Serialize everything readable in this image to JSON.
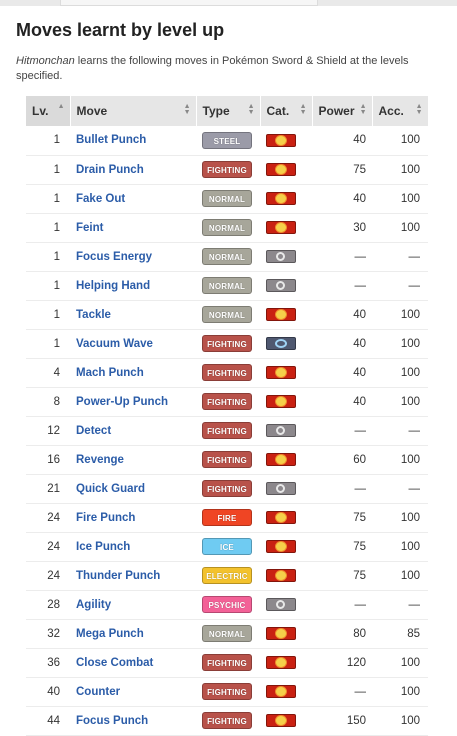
{
  "heading": "Moves learnt by level up",
  "intro": {
    "pokemon": "Hitmonchan",
    "text": " learns the following moves in Pokémon Sword & Shield at the levels specified."
  },
  "colors": {
    "Steel": "#9b9ba8",
    "Fighting": "#b8524a",
    "Normal": "#a7a69a",
    "Fire": "#ef4524",
    "Ice": "#6fcbf2",
    "Electric": "#f3c22d",
    "Psychic": "#f36197"
  },
  "columns": [
    "Lv.",
    "Move",
    "Type",
    "Cat.",
    "Power",
    "Acc."
  ],
  "moves": [
    {
      "lv": "1",
      "name": "Bullet Punch",
      "type": "Steel",
      "cat": "physical",
      "power": "40",
      "acc": "100"
    },
    {
      "lv": "1",
      "name": "Drain Punch",
      "type": "Fighting",
      "cat": "physical",
      "power": "75",
      "acc": "100"
    },
    {
      "lv": "1",
      "name": "Fake Out",
      "type": "Normal",
      "cat": "physical",
      "power": "40",
      "acc": "100"
    },
    {
      "lv": "1",
      "name": "Feint",
      "type": "Normal",
      "cat": "physical",
      "power": "30",
      "acc": "100"
    },
    {
      "lv": "1",
      "name": "Focus Energy",
      "type": "Normal",
      "cat": "status",
      "power": "—",
      "acc": "—"
    },
    {
      "lv": "1",
      "name": "Helping Hand",
      "type": "Normal",
      "cat": "status",
      "power": "—",
      "acc": "—"
    },
    {
      "lv": "1",
      "name": "Tackle",
      "type": "Normal",
      "cat": "physical",
      "power": "40",
      "acc": "100"
    },
    {
      "lv": "1",
      "name": "Vacuum Wave",
      "type": "Fighting",
      "cat": "special",
      "power": "40",
      "acc": "100"
    },
    {
      "lv": "4",
      "name": "Mach Punch",
      "type": "Fighting",
      "cat": "physical",
      "power": "40",
      "acc": "100"
    },
    {
      "lv": "8",
      "name": "Power-Up Punch",
      "type": "Fighting",
      "cat": "physical",
      "power": "40",
      "acc": "100"
    },
    {
      "lv": "12",
      "name": "Detect",
      "type": "Fighting",
      "cat": "status",
      "power": "—",
      "acc": "—"
    },
    {
      "lv": "16",
      "name": "Revenge",
      "type": "Fighting",
      "cat": "physical",
      "power": "60",
      "acc": "100"
    },
    {
      "lv": "21",
      "name": "Quick Guard",
      "type": "Fighting",
      "cat": "status",
      "power": "—",
      "acc": "—"
    },
    {
      "lv": "24",
      "name": "Fire Punch",
      "type": "Fire",
      "cat": "physical",
      "power": "75",
      "acc": "100"
    },
    {
      "lv": "24",
      "name": "Ice Punch",
      "type": "Ice",
      "cat": "physical",
      "power": "75",
      "acc": "100"
    },
    {
      "lv": "24",
      "name": "Thunder Punch",
      "type": "Electric",
      "cat": "physical",
      "power": "75",
      "acc": "100"
    },
    {
      "lv": "28",
      "name": "Agility",
      "type": "Psychic",
      "cat": "status",
      "power": "—",
      "acc": "—"
    },
    {
      "lv": "32",
      "name": "Mega Punch",
      "type": "Normal",
      "cat": "physical",
      "power": "80",
      "acc": "85"
    },
    {
      "lv": "36",
      "name": "Close Combat",
      "type": "Fighting",
      "cat": "physical",
      "power": "120",
      "acc": "100"
    },
    {
      "lv": "40",
      "name": "Counter",
      "type": "Fighting",
      "cat": "physical",
      "power": "—",
      "acc": "100"
    },
    {
      "lv": "44",
      "name": "Focus Punch",
      "type": "Fighting",
      "cat": "physical",
      "power": "150",
      "acc": "100"
    }
  ]
}
